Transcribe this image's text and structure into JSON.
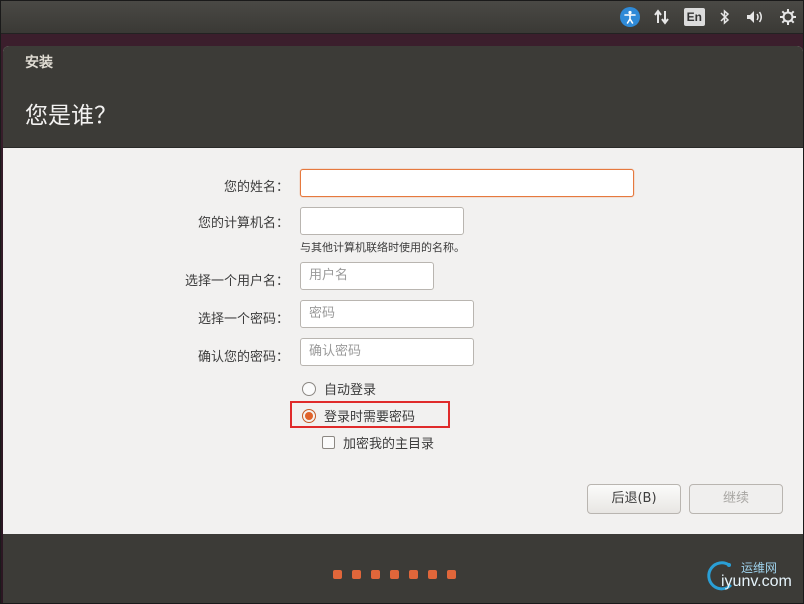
{
  "tray": {
    "icons": [
      "accessibility-icon",
      "network-updown-icon",
      "keyboard-layout-icon",
      "bluetooth-icon",
      "volume-icon",
      "gear-power-icon"
    ],
    "keyboard_layout": "En"
  },
  "window": {
    "title": "安装",
    "page_title": "您是谁？"
  },
  "form": {
    "name_label": "您的姓名：",
    "name_value": "",
    "computer_label": "您的计算机名：",
    "computer_value": "",
    "computer_hint": "与其他计算机联络时使用的名称。",
    "username_label": "选择一个用户名：",
    "username_placeholder": "用户名",
    "password_label": "选择一个密码：",
    "password_placeholder": "密码",
    "confirm_label": "确认您的密码：",
    "confirm_placeholder": "确认密码",
    "auto_login": "自动登录",
    "require_password": "登录时需要密码",
    "encrypt_home": "加密我的主目录",
    "selected_option": "require_password"
  },
  "buttons": {
    "back": "后退(B)",
    "continue": "继续"
  },
  "progress": {
    "dots": 7
  },
  "watermark": {
    "cn": "运维网",
    "en": "iyunv.com"
  },
  "colors": {
    "accent": "#e0622a",
    "highlight": "#e02b2b",
    "header": "#3c3b37"
  }
}
